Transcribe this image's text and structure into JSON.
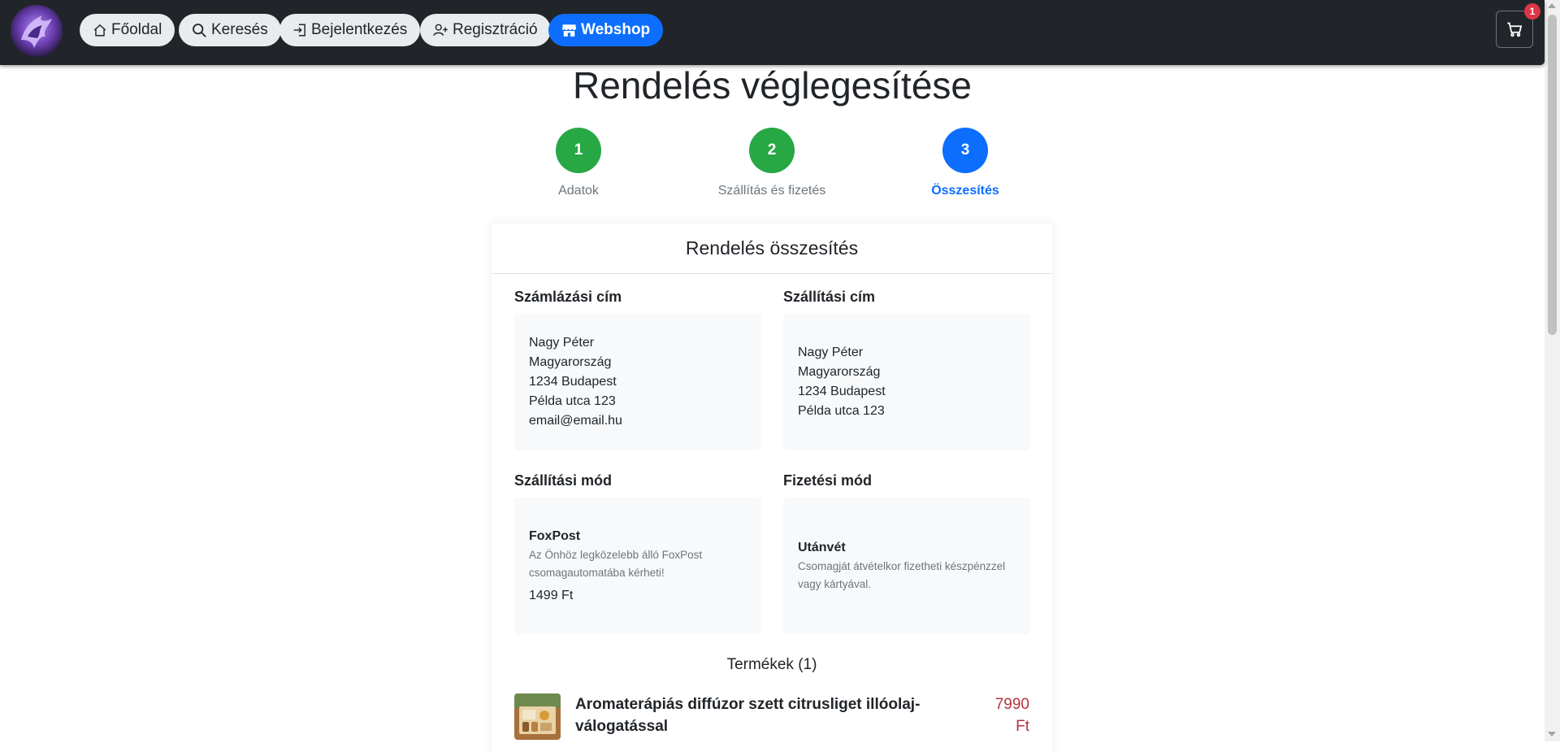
{
  "navbar": {
    "items": [
      {
        "label": "Főoldal",
        "icon": "home-icon"
      },
      {
        "label": "Keresés",
        "icon": "search-icon"
      },
      {
        "label": "Bejelentkezés",
        "icon": "login-icon"
      },
      {
        "label": "Regisztráció",
        "icon": "user-plus-icon"
      },
      {
        "label": "Webshop",
        "icon": "shop-icon",
        "active": true
      }
    ],
    "cart_count": "1"
  },
  "page_title": "Rendelés véglegesítése",
  "steps": [
    {
      "number": "1",
      "label": "Adatok",
      "state": "done"
    },
    {
      "number": "2",
      "label": "Szállítás és fizetés",
      "state": "done"
    },
    {
      "number": "3",
      "label": "Összesítés",
      "state": "current"
    }
  ],
  "summary": {
    "title": "Rendelés összesítés",
    "billing": {
      "title": "Számlázási cím",
      "name": "Nagy Péter",
      "country": "Magyarország",
      "city": "1234 Budapest",
      "street": "Példa utca 123",
      "email": "email@email.hu"
    },
    "shipping_address": {
      "title": "Szállítási cím",
      "name": "Nagy Péter",
      "country": "Magyarország",
      "city": "1234 Budapest",
      "street": "Példa utca 123"
    },
    "shipping_method": {
      "title": "Szállítási mód",
      "name": "FoxPost",
      "description": "Az Önhöz legközelebb álló FoxPost csomagautomatába kérheti!",
      "price": "1499 Ft"
    },
    "payment_method": {
      "title": "Fizetési mód",
      "name": "Utánvét",
      "description": "Csomagját átvételkor fizetheti készpénzzel vagy kártyával."
    },
    "products_title": "Termékek (1)",
    "products": [
      {
        "name": "Aromaterápiás diffúzor szett citrusliget illóolaj-válogatással",
        "price_amount": "7990",
        "price_currency": "Ft"
      }
    ]
  },
  "colors": {
    "navbar_bg": "#212529",
    "primary": "#0d6efd",
    "success": "#28a745",
    "price": "#b5323f"
  }
}
